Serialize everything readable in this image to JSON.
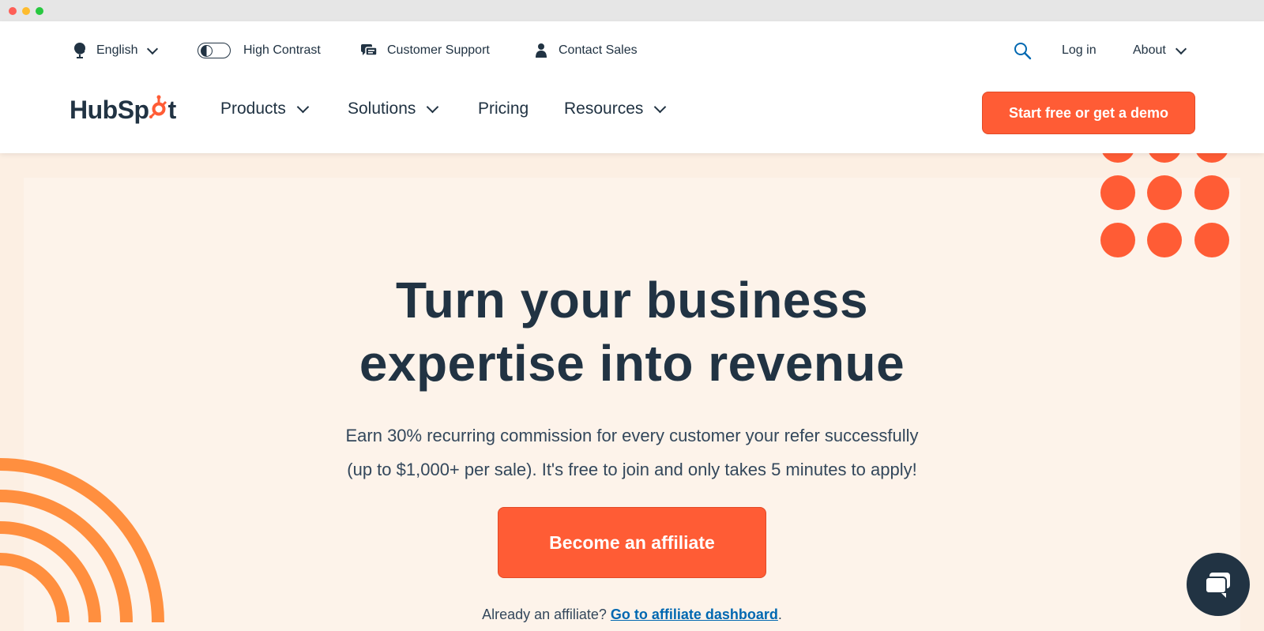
{
  "utility_nav": {
    "language": "English",
    "high_contrast": "High Contrast",
    "customer_support": "Customer Support",
    "contact_sales": "Contact Sales",
    "log_in": "Log in",
    "about": "About"
  },
  "brand": {
    "logo_text_left": "HubSp",
    "logo_text_right": "t",
    "accent_color": "#ff5c35",
    "text_color": "#213343"
  },
  "main_nav": {
    "products": "Products",
    "solutions": "Solutions",
    "pricing": "Pricing",
    "resources": "Resources",
    "cta": "Start free or get a demo"
  },
  "hero": {
    "title_line1": "Turn your business",
    "title_line2": "expertise into revenue",
    "subtitle_line1": "Earn 30% recurring commission for every customer your refer successfully",
    "subtitle_line2": "(up to $1,000+ per sale). It's free to join and only takes 5 minutes to apply!",
    "cta": "Become an affiliate",
    "already_text": "Already an affiliate?",
    "dashboard_link": "Go to affiliate dashboard",
    "trailing": "."
  },
  "icons": {
    "globe": "globe-icon",
    "contrast_toggle": "contrast-toggle-icon",
    "chat_bubbles": "chat-bubbles-icon",
    "person": "person-icon",
    "search": "search-icon",
    "chevron": "chevron-down-icon",
    "chat_widget": "chat-icon"
  }
}
